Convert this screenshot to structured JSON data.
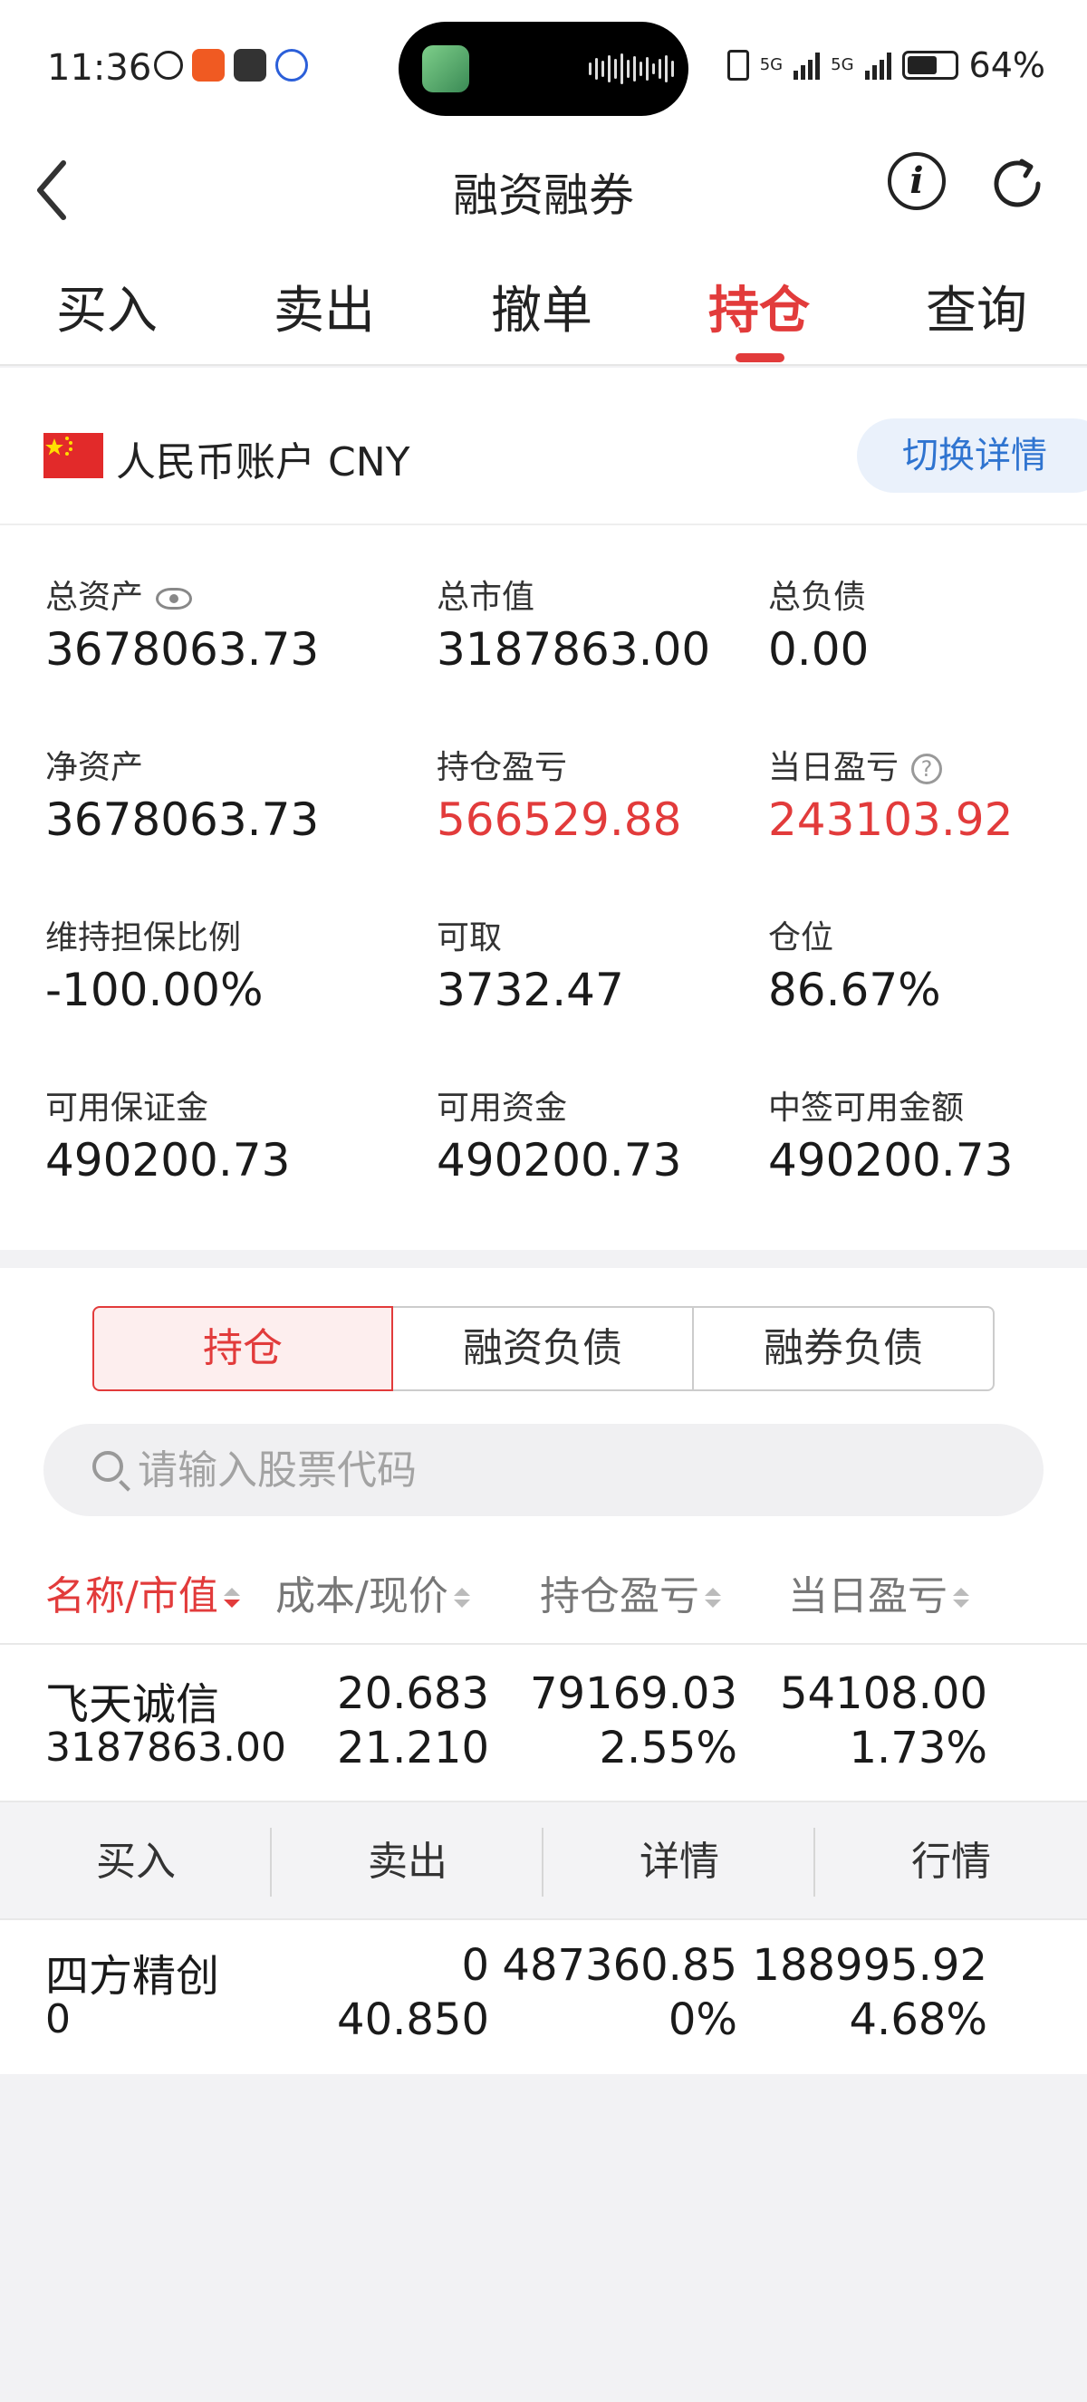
{
  "status_bar": {
    "time": "11:36",
    "battery_percent": "64%",
    "battery_level": 0.64,
    "network": [
      "5G",
      "5G"
    ]
  },
  "header": {
    "title": "融资融券",
    "back_icon": "chevron-left-icon",
    "info_icon": "info-icon",
    "refresh_icon": "refresh-icon"
  },
  "tabs": [
    {
      "label": "买入",
      "active": false
    },
    {
      "label": "卖出",
      "active": false
    },
    {
      "label": "撤单",
      "active": false
    },
    {
      "label": "持仓",
      "active": true
    },
    {
      "label": "查询",
      "active": false
    }
  ],
  "account": {
    "label": "人民币账户 CNY",
    "switch_label": "切换详情"
  },
  "stats": [
    {
      "label": "总资产",
      "value": "3678063.73"
    },
    {
      "label": "总市值",
      "value": "3187863.00"
    },
    {
      "label": "总负债",
      "value": "0.00"
    },
    {
      "label": "净资产",
      "value": "3678063.73"
    },
    {
      "label": "持仓盈亏",
      "value": "566529.88"
    },
    {
      "label": "当日盈亏",
      "value": "243103.92"
    },
    {
      "label": "维持担保比例",
      "value": "-100.00%"
    },
    {
      "label": "可取",
      "value": "3732.47"
    },
    {
      "label": "仓位",
      "value": "86.67%"
    },
    {
      "label": "可用保证金",
      "value": "490200.73"
    },
    {
      "label": "可用资金",
      "value": "490200.73"
    },
    {
      "label": "中签可用金额",
      "value": "490200.73"
    }
  ],
  "help_mark": "?",
  "segments": [
    {
      "label": "持仓",
      "active": true
    },
    {
      "label": "融资负债",
      "active": false
    },
    {
      "label": "融券负债",
      "active": false
    }
  ],
  "search": {
    "placeholder": "请输入股票代码"
  },
  "columns": [
    "名称/市值",
    "成本/现价",
    "持仓盈亏",
    "当日盈亏"
  ],
  "holdings": [
    {
      "name": "飞天诚信",
      "market_value": "3187863.00",
      "cost": "20.683",
      "price": "21.210",
      "pnl": "79169.03",
      "pnl_pct": "2.55%",
      "day_pnl": "54108.00",
      "day_pnl_pct": "1.73%"
    },
    {
      "name": "四方精创",
      "market_value": "0",
      "cost": "0",
      "price": "40.850",
      "pnl": "487360.85",
      "pnl_pct": "0%",
      "day_pnl": "188995.92",
      "day_pnl_pct": "4.68%"
    }
  ],
  "row_actions": [
    "买入",
    "卖出",
    "详情",
    "行情"
  ],
  "colors": {
    "accent_red": "#e23b3b",
    "link_blue": "#2f74d0"
  }
}
